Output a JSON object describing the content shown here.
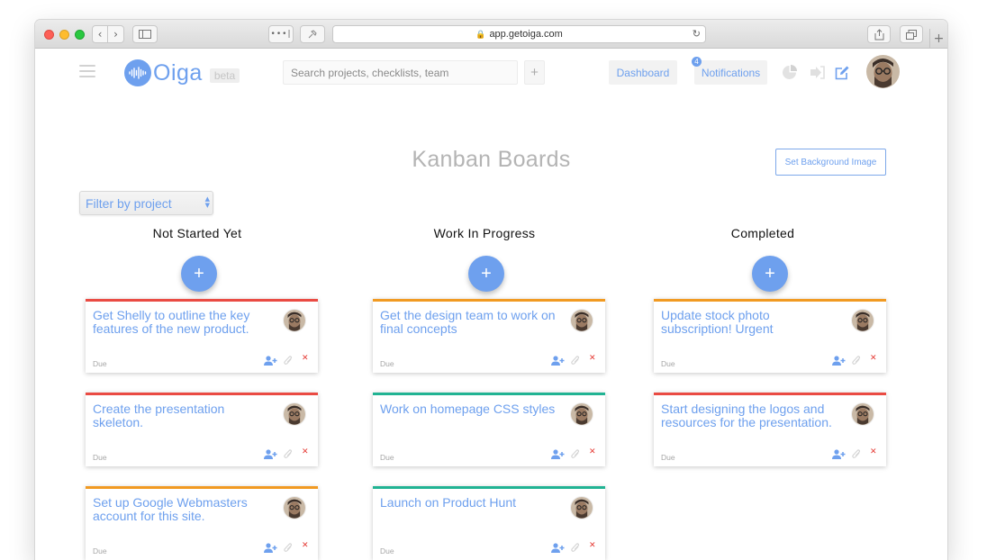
{
  "browser": {
    "url": "app.getoiga.com"
  },
  "header": {
    "logo_text": "Oiga",
    "beta_label": "beta",
    "search_placeholder": "Search projects, checklists, team",
    "add_label": "+",
    "dashboard_label": "Dashboard",
    "notifications_label": "Notifications",
    "notifications_count": "4"
  },
  "page": {
    "title": "Kanban Boards",
    "bg_button_label": "Set Background Image",
    "filter_label": "Filter by project",
    "add_label": "+"
  },
  "columns": [
    {
      "title": "Not Started Yet",
      "cards": [
        {
          "title": "Get Shelly to outline the key features of the new product.",
          "due": "Due",
          "color": "#ea4b43"
        },
        {
          "title": "Create the presentation skeleton.",
          "due": "Due",
          "color": "#ea4b43"
        },
        {
          "title": "Set up Google Webmasters account for this site.",
          "due": "Due",
          "color": "#f19a22"
        }
      ]
    },
    {
      "title": "Work In Progress",
      "cards": [
        {
          "title": "Get the design team to work on final concepts",
          "due": "Due",
          "color": "#f19a22"
        },
        {
          "title": "Work on homepage CSS styles",
          "due": "Due",
          "color": "#21b393"
        },
        {
          "title": "Launch on Product Hunt",
          "due": "Due",
          "color": "#21b393"
        }
      ]
    },
    {
      "title": "Completed",
      "cards": [
        {
          "title": "Update stock photo subscription! Urgent",
          "due": "Due",
          "color": "#f19a22"
        },
        {
          "title": "Start designing the logos and resources for the presentation.",
          "due": "Due",
          "color": "#ea4b43"
        }
      ]
    }
  ],
  "colors": {
    "accent": "#6ea0ee",
    "red": "#ea4b43",
    "orange": "#f19a22",
    "green": "#21b393"
  },
  "icons": [
    "menu-icon",
    "logo-waveform-icon",
    "pie-chart-icon",
    "logout-icon",
    "edit-icon",
    "user-avatar",
    "assign-user-icon",
    "paperclip-icon",
    "delete-icon"
  ]
}
